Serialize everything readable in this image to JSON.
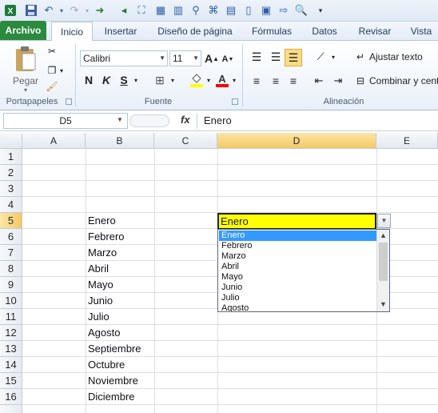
{
  "qat": {
    "icons": [
      "excel-logo-icon",
      "save-icon",
      "undo-icon",
      "redo-icon",
      "forward-icon",
      "back-icon",
      "toolbar-icon",
      "toolbar-icon",
      "toolbar-icon",
      "toolbar-icon",
      "toolbar-icon",
      "toolbar-icon",
      "toolbar-icon",
      "toolbar-icon",
      "preview-icon",
      "customize-icon"
    ]
  },
  "tabs": {
    "file": "Archivo",
    "home": "Inicio",
    "insert": "Insertar",
    "layout": "Diseño de página",
    "formulas": "Fórmulas",
    "data": "Datos",
    "review": "Revisar",
    "view": "Vista"
  },
  "ribbon": {
    "clipboard": {
      "paste": "Pegar",
      "label": "Portapapeles"
    },
    "font": {
      "name": "Calibri",
      "size": "11",
      "bold": "N",
      "italic": "K",
      "underline": "S",
      "label": "Fuente",
      "font_color": "#ff0000",
      "fill_color": "#ffff00"
    },
    "alignment": {
      "wrap": "Ajustar texto",
      "merge": "Combinar y centr",
      "label": "Alineación"
    }
  },
  "formula_bar": {
    "name_box": "D5",
    "fx": "fx",
    "value": "Enero"
  },
  "columns": [
    "A",
    "B",
    "C",
    "D",
    "E"
  ],
  "rows": [
    "1",
    "2",
    "3",
    "4",
    "5",
    "6",
    "7",
    "8",
    "9",
    "10",
    "11",
    "12",
    "13",
    "14",
    "15",
    "16"
  ],
  "column_b": [
    "Enero",
    "Febrero",
    "Marzo",
    "Abril",
    "Mayo",
    "Junio",
    "Julio",
    "Agosto",
    "Septiembre",
    "Octubre",
    "Noviembre",
    "Diciembre"
  ],
  "active_cell": {
    "value": "Enero",
    "fill": "#ffff00"
  },
  "dropdown": {
    "items": [
      "Enero",
      "Febrero",
      "Marzo",
      "Abril",
      "Mayo",
      "Junio",
      "Julio",
      "Agosto"
    ],
    "selected": "Enero"
  }
}
